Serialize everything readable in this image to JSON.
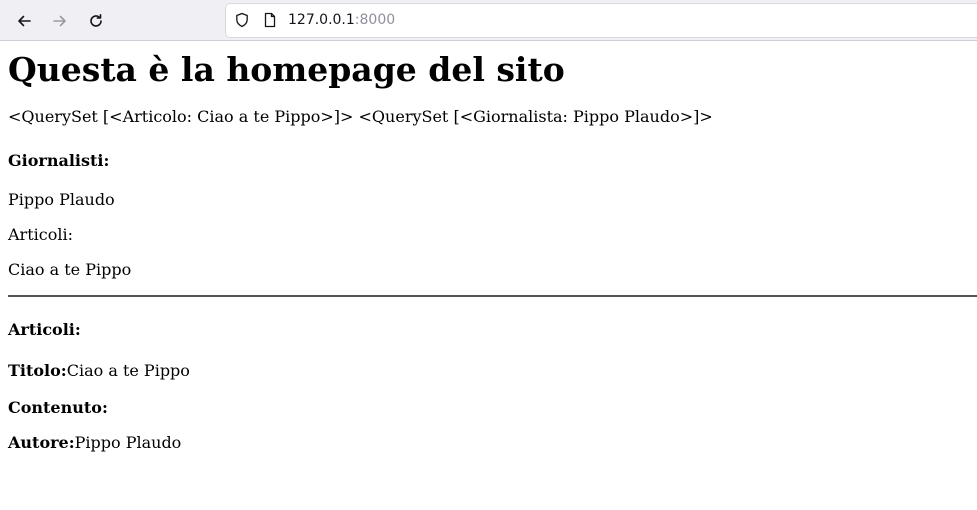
{
  "browser": {
    "url_host": "127.0.0.1",
    "url_port": ":8000"
  },
  "page": {
    "heading": "Questa è la homepage del sito",
    "queryset_line": "<QuerySet [<Articolo: Ciao a te Pippo>]> <QuerySet [<Giornalista: Pippo Plaudo>]>",
    "giornalisti_heading": "Giornalisti:",
    "giornalista_name": "Pippo Plaudo",
    "articoli_label": "Articoli:",
    "articolo_title": "Ciao a te Pippo",
    "articoli_heading": "Articoli:",
    "titolo_label": "Titolo:",
    "titolo_value": "Ciao a te Pippo",
    "contenuto_label": "Contenuto:",
    "autore_label": "Autore:",
    "autore_value": "Pippo Plaudo"
  }
}
